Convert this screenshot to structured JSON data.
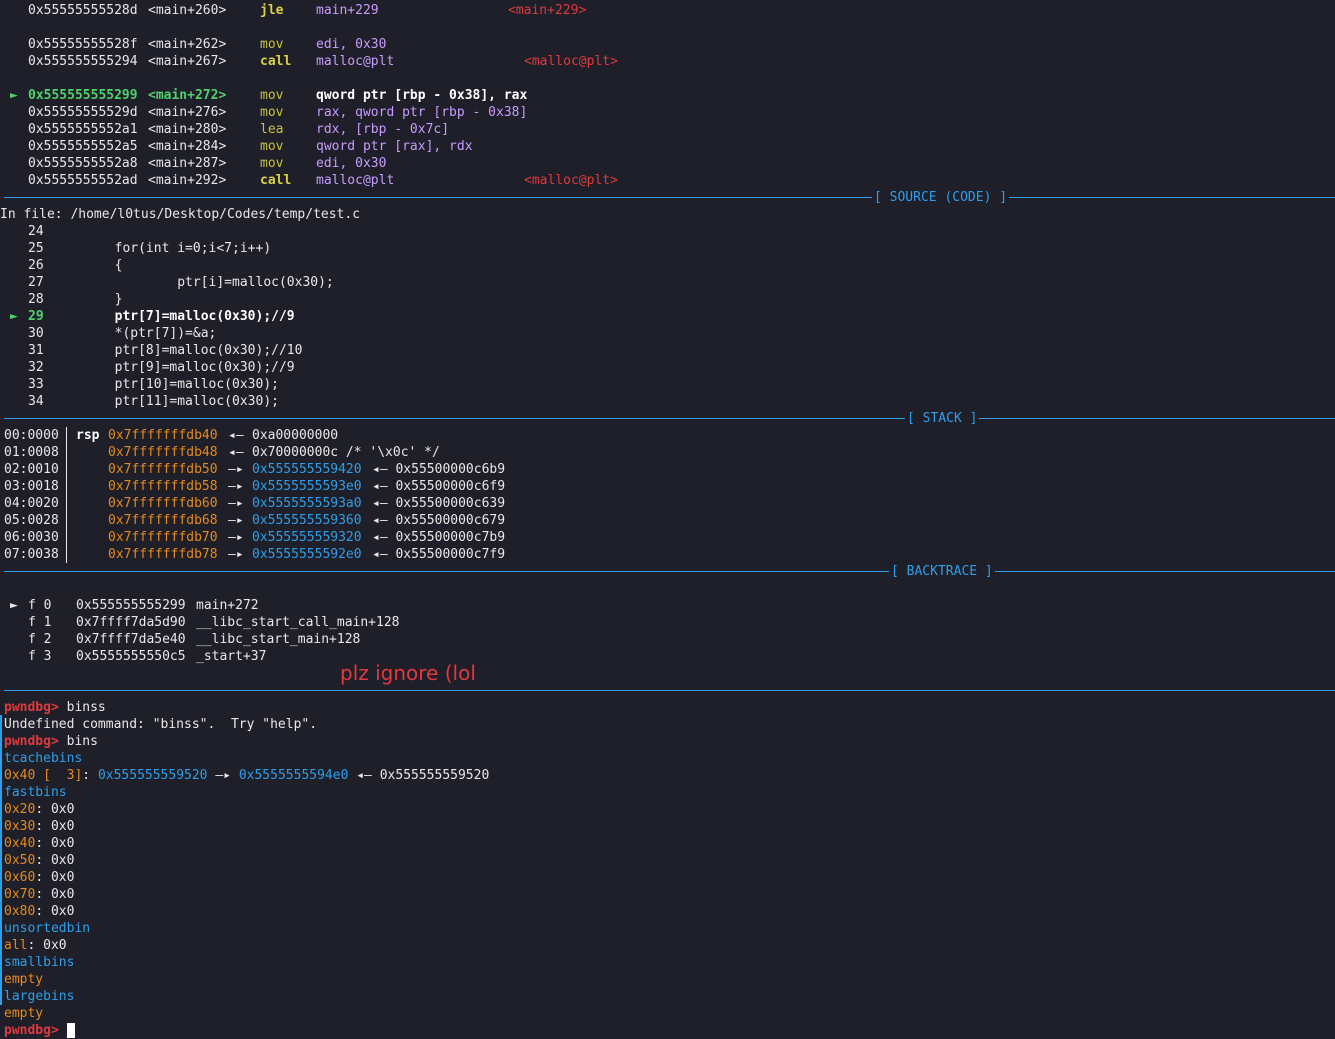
{
  "disasm": {
    "rows": [
      {
        "addr": "0x55555555528d",
        "off": "<main+260>",
        "mn": "jle",
        "ops": "main+229",
        "ann": "<main+229>"
      },
      {
        "blank": true
      },
      {
        "addr": "0x55555555528f",
        "off": "<main+262>",
        "mn": "mov",
        "ops": "edi, 0x30",
        "ann": ""
      },
      {
        "addr": "0x555555555294",
        "off": "<main+267>",
        "mn": "call",
        "ops": "malloc@plt",
        "ann": "<malloc@plt>"
      },
      {
        "blank": true
      },
      {
        "addr": "0x555555555299",
        "off": "<main+272>",
        "mn": "mov",
        "ops": "qword ptr [rbp - 0x38], rax",
        "ann": "",
        "current": true
      },
      {
        "addr": "0x55555555529d",
        "off": "<main+276>",
        "mn": "mov",
        "ops": "rax, qword ptr [rbp - 0x38]",
        "ann": ""
      },
      {
        "addr": "0x5555555552a1",
        "off": "<main+280>",
        "mn": "lea",
        "ops": "rdx, [rbp - 0x7c]",
        "ann": ""
      },
      {
        "addr": "0x5555555552a5",
        "off": "<main+284>",
        "mn": "mov",
        "ops": "qword ptr [rax], rdx",
        "ann": ""
      },
      {
        "addr": "0x5555555552a8",
        "off": "<main+287>",
        "mn": "mov",
        "ops": "edi, 0x30",
        "ann": ""
      },
      {
        "addr": "0x5555555552ad",
        "off": "<main+292>",
        "mn": "call",
        "ops": "malloc@plt",
        "ann": "<malloc@plt>"
      }
    ]
  },
  "source": {
    "header": "[ SOURCE (CODE) ]",
    "file": "In file: /home/l0tus/Desktop/Codes/temp/test.c",
    "lines": [
      {
        "n": "24",
        "code": ""
      },
      {
        "n": "25",
        "code": "        for(int i=0;i<7;i++)"
      },
      {
        "n": "26",
        "code": "        {"
      },
      {
        "n": "27",
        "code": "                ptr[i]=malloc(0x30);"
      },
      {
        "n": "28",
        "code": "        }"
      },
      {
        "n": "29",
        "code": "        ptr[7]=malloc(0x30);//9",
        "current": true
      },
      {
        "n": "30",
        "code": "        *(ptr[7])=&a;"
      },
      {
        "n": "31",
        "code": "        ptr[8]=malloc(0x30);//10"
      },
      {
        "n": "32",
        "code": "        ptr[9]=malloc(0x30);//9"
      },
      {
        "n": "33",
        "code": "        ptr[10]=malloc(0x30);"
      },
      {
        "n": "34",
        "code": "        ptr[11]=malloc(0x30);"
      }
    ]
  },
  "stack": {
    "header": "[ STACK ]",
    "rows": [
      {
        "idx": "00:0000",
        "reg": "rsp",
        "addr": "0x7fffffffdb40",
        "arrow": "◂—",
        "v1": "0xa00000000",
        "v1c": "white",
        "v2": ""
      },
      {
        "idx": "01:0008",
        "reg": "",
        "addr": "0x7fffffffdb48",
        "arrow": "◂—",
        "v1": "0x70000000c /* '\\x0c' */",
        "v1c": "white",
        "v2": ""
      },
      {
        "idx": "02:0010",
        "reg": "",
        "addr": "0x7fffffffdb50",
        "arrow": "—▸",
        "v1": "0x555555559420",
        "v1c": "cyan",
        "v2": "◂— 0x55500000c6b9"
      },
      {
        "idx": "03:0018",
        "reg": "",
        "addr": "0x7fffffffdb58",
        "arrow": "—▸",
        "v1": "0x5555555593e0",
        "v1c": "cyan",
        "v2": "◂— 0x55500000c6f9"
      },
      {
        "idx": "04:0020",
        "reg": "",
        "addr": "0x7fffffffdb60",
        "arrow": "—▸",
        "v1": "0x5555555593a0",
        "v1c": "cyan",
        "v2": "◂— 0x55500000c639"
      },
      {
        "idx": "05:0028",
        "reg": "",
        "addr": "0x7fffffffdb68",
        "arrow": "—▸",
        "v1": "0x555555559360",
        "v1c": "cyan",
        "v2": "◂— 0x55500000c679"
      },
      {
        "idx": "06:0030",
        "reg": "",
        "addr": "0x7fffffffdb70",
        "arrow": "—▸",
        "v1": "0x555555559320",
        "v1c": "cyan",
        "v2": "◂— 0x55500000c7b9"
      },
      {
        "idx": "07:0038",
        "reg": "",
        "addr": "0x7fffffffdb78",
        "arrow": "—▸",
        "v1": "0x5555555592e0",
        "v1c": "cyan",
        "v2": "◂— 0x55500000c7f9"
      }
    ]
  },
  "backtrace": {
    "header": "[ BACKTRACE ]",
    "frames": [
      {
        "marker": "►",
        "f": "f 0",
        "addr": "0x555555555299",
        "sym": "main+272"
      },
      {
        "marker": "",
        "f": "f 1",
        "addr": "0x7ffff7da5d90",
        "sym": "__libc_start_call_main+128"
      },
      {
        "marker": "",
        "f": "f 2",
        "addr": "0x7ffff7da5e40",
        "sym": "__libc_start_main+128"
      },
      {
        "marker": "",
        "f": "f 3",
        "addr": "0x5555555550c5",
        "sym": "_start+37"
      }
    ]
  },
  "console": {
    "prompt": "pwndbg>",
    "cmd1": " binss",
    "err": "Undefined command: \"binss\".  Try \"help\".",
    "cmd2": " bins",
    "tcache_label": "tcachebins",
    "tcache_entry": {
      "size": "0x40 [  3]",
      "colon": ":",
      "p1": "0x555555559520",
      "arrow": "—▸",
      "p2": "0x5555555594e0",
      "tail": "◂— 0x555555559520"
    },
    "fast_label": "fastbins",
    "fast": [
      {
        "k": "0x20",
        "v": "0x0"
      },
      {
        "k": "0x30",
        "v": "0x0"
      },
      {
        "k": "0x40",
        "v": "0x0"
      },
      {
        "k": "0x50",
        "v": "0x0"
      },
      {
        "k": "0x60",
        "v": "0x0"
      },
      {
        "k": "0x70",
        "v": "0x0"
      },
      {
        "k": "0x80",
        "v": "0x0"
      }
    ],
    "unsorted_label": "unsortedbin",
    "unsorted_all_k": "all",
    "unsorted_all_v": ": 0x0",
    "small_label": "smallbins",
    "small_v": "empty",
    "large_label": "largebins",
    "large_v": "empty"
  },
  "annotation": "plz ignore (lol",
  "colors": {
    "bg": "#1e1f29",
    "accent": "#2f9ee9",
    "red": "#e0393e",
    "green": "#4fd26b",
    "orange": "#e58a1f",
    "yellow": "#d8d243",
    "purple": "#b78cff"
  }
}
